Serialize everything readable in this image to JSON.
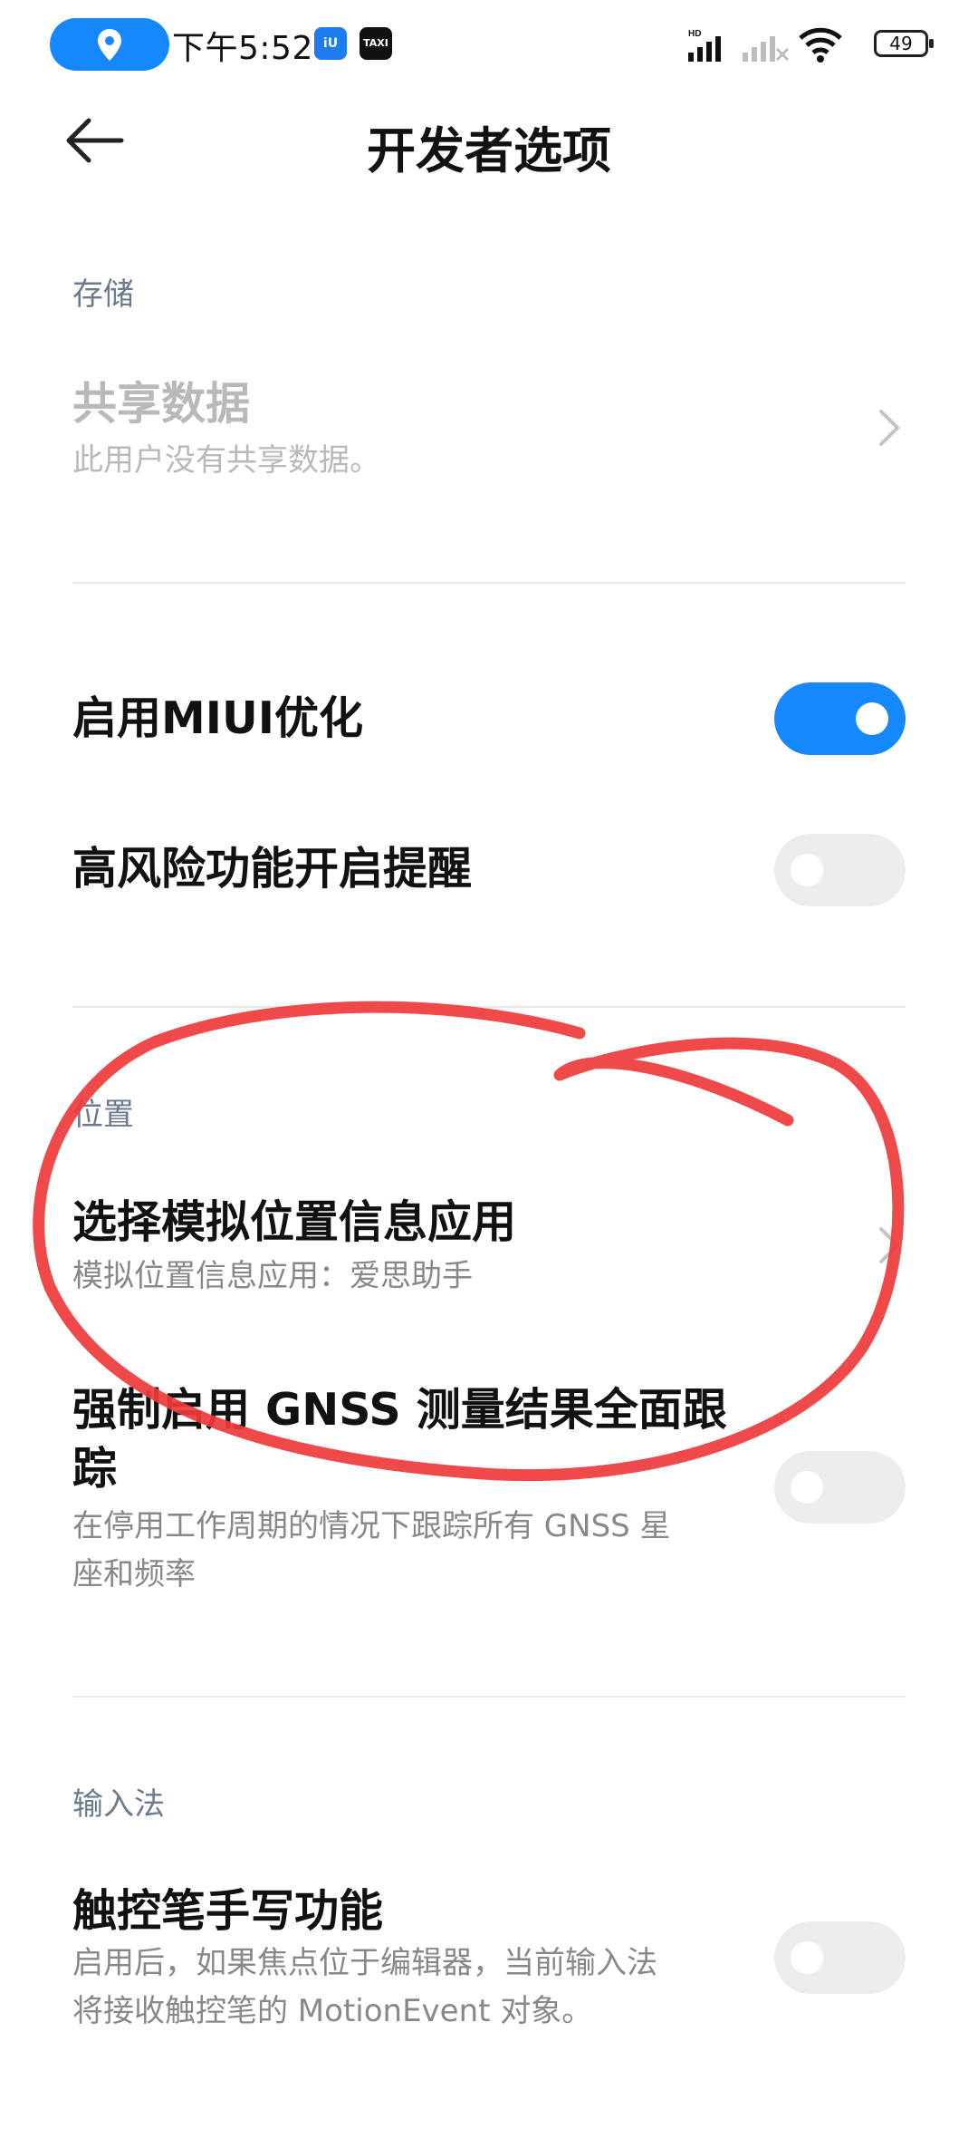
{
  "status_bar": {
    "time": "下午5:52",
    "battery": "49",
    "app_badge_a": "iU",
    "app_badge_b": "TAXI",
    "hd_label": "HD",
    "colors": {
      "location_pill": "#1588ff"
    }
  },
  "header": {
    "title": "开发者选项",
    "back_icon": "back-arrow-icon"
  },
  "sections": {
    "storage": {
      "label": "存储",
      "shared_data": {
        "title": "共享数据",
        "subtitle": "此用户没有共享数据。",
        "disabled": true
      }
    },
    "miui": {
      "enable_miui_opt": {
        "title": "启用MIUI优化",
        "toggle_on": true
      },
      "high_risk_reminder": {
        "title": "高风险功能开启提醒",
        "toggle_on": false
      }
    },
    "location": {
      "label": "位置",
      "mock_location_app": {
        "title": "选择模拟位置信息应用",
        "subtitle": "模拟位置信息应用：爱思助手"
      },
      "force_gnss": {
        "title_line1": "强制启用 GNSS 测量结果全面跟",
        "title_line2": "踪",
        "subtitle_line1": "在停用工作周期的情况下跟踪所有 GNSS 星",
        "subtitle_line2": "座和频率",
        "toggle_on": false
      }
    },
    "input_method": {
      "label": "输入法",
      "stylus_handwriting": {
        "title": "触控笔手写功能",
        "subtitle_line1": "启用后，如果焦点位于编辑器，当前输入法",
        "subtitle_line2": "将接收触控笔的 MotionEvent 对象。",
        "toggle_on": false
      }
    }
  },
  "colors": {
    "accent": "#1588ff",
    "annotation": "#ef3a3a",
    "section_label": "#6b7a90"
  }
}
